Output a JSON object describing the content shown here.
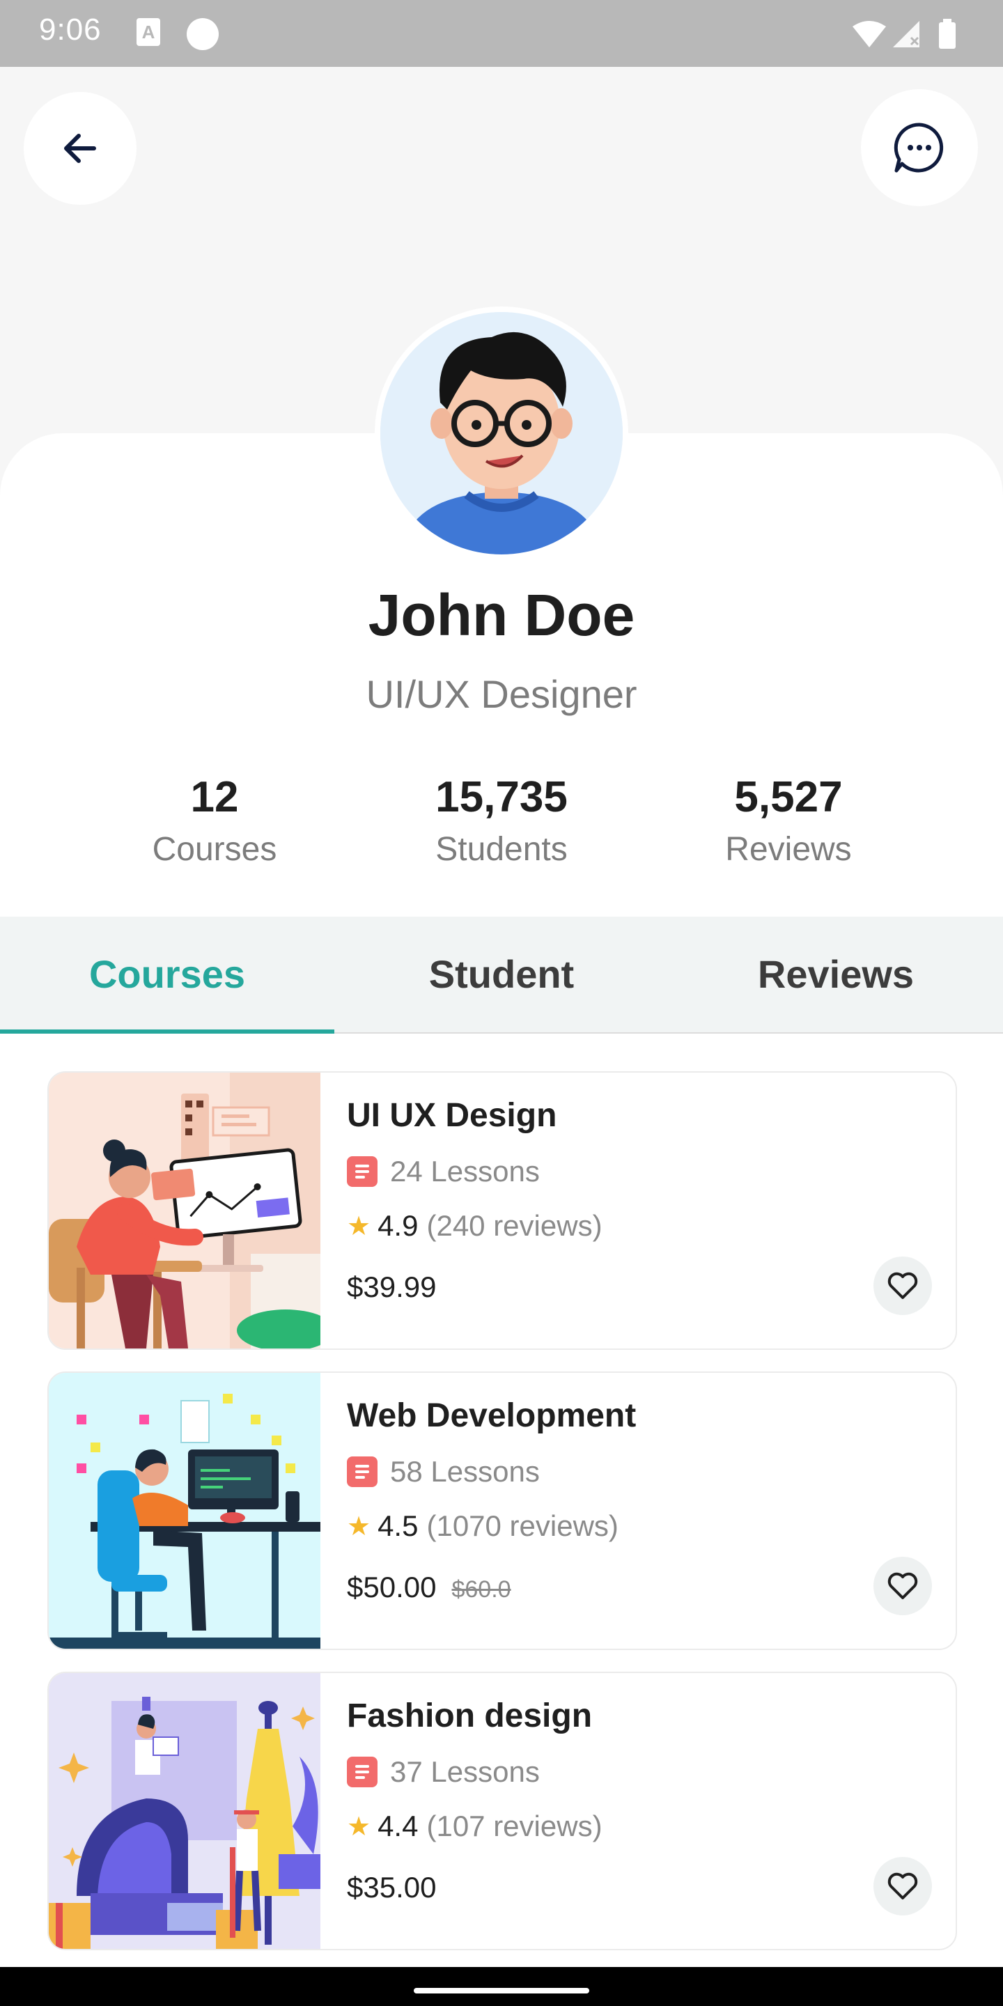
{
  "status_bar": {
    "time": "9:06"
  },
  "profile": {
    "name": "John Doe",
    "role": "UI/UX Designer"
  },
  "stats": [
    {
      "value": "12",
      "label": "Courses"
    },
    {
      "value": "15,735",
      "label": "Students"
    },
    {
      "value": "5,527",
      "label": "Reviews"
    }
  ],
  "tabs": [
    {
      "label": "Courses",
      "active": true
    },
    {
      "label": "Student",
      "active": false
    },
    {
      "label": "Reviews",
      "active": false
    }
  ],
  "courses": [
    {
      "title": "UI UX Design",
      "lessons": "24 Lessons",
      "rating": "4.9",
      "reviews": "(240 reviews)",
      "price": "$39.99",
      "old_price": ""
    },
    {
      "title": "Web Development",
      "lessons": "58 Lessons",
      "rating": "4.5",
      "reviews": "(1070 reviews)",
      "price": "$50.00",
      "old_price": "$60.0"
    },
    {
      "title": "Fashion design",
      "lessons": "37 Lessons",
      "rating": "4.4",
      "reviews": "(107 reviews)",
      "price": "$35.00",
      "old_price": ""
    }
  ],
  "colors": {
    "accent": "#25a79c",
    "lesson_icon": "#f26b6b",
    "star": "#f5b82b"
  },
  "icons": {
    "back": "arrow-left-icon",
    "chat": "chat-bubble-icon",
    "lesson": "document-icon",
    "rating": "star-icon",
    "favorite": "heart-icon"
  }
}
